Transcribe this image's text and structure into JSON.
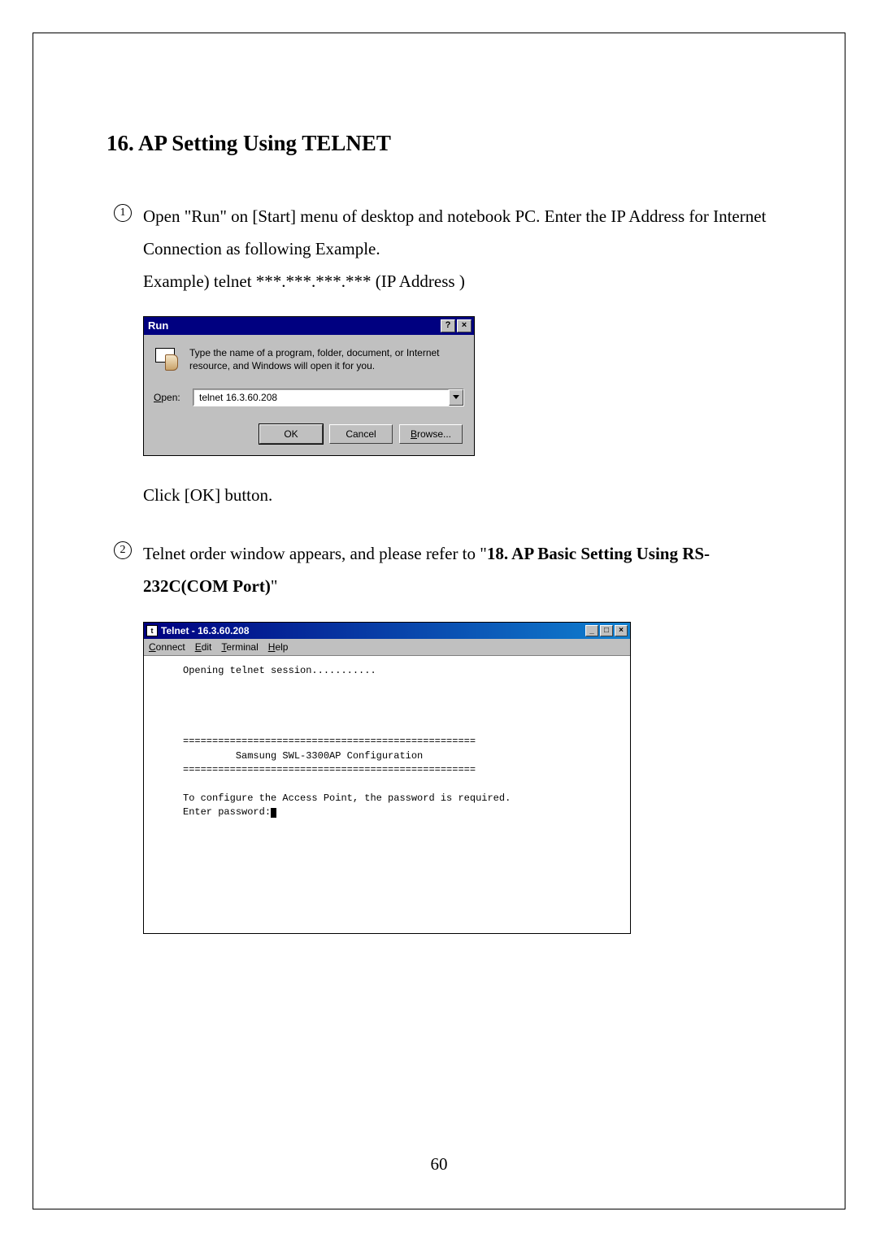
{
  "heading": "16. AP Setting Using TELNET",
  "steps": {
    "item1": {
      "marker": "1",
      "line1": "Open \"Run\" on [Start] menu of desktop and notebook PC. Enter the IP Address for Internet Connection as following Example.",
      "line2": "Example) telnet ***.***.***.*** (IP Address )"
    },
    "click_ok": "Click [OK] button.",
    "item2": {
      "marker": "2",
      "prefix": "Telnet order window appears, and please refer to \"",
      "bold": "18. AP Basic Setting Using RS-232C(COM Port)",
      "suffix": "\""
    }
  },
  "run_dialog": {
    "title": "Run",
    "help_btn": "?",
    "close_btn": "×",
    "description": "Type the name of a program, folder, document, or Internet resource, and Windows will open it for you.",
    "open_label_ul": "O",
    "open_label_rest": "pen:",
    "open_value": "telnet  16.3.60.208",
    "ok": "OK",
    "cancel": "Cancel",
    "browse_ul": "B",
    "browse_rest": "rowse..."
  },
  "telnet": {
    "title": "Telnet - 16.3.60.208",
    "min_btn": "_",
    "max_btn": "□",
    "close_btn": "×",
    "menu": {
      "connect_ul": "C",
      "connect_rest": "onnect",
      "edit_ul": "E",
      "edit_rest": "dit",
      "terminal_ul": "T",
      "terminal_rest": "erminal",
      "help_ul": "H",
      "help_rest": "elp"
    },
    "body_line1": "     Opening telnet session...........",
    "body_sep1": "     ==================================================",
    "body_confg": "              Samsung SWL-3300AP Configuration",
    "body_sep2": "     ==================================================",
    "body_note": "     To configure the Access Point, the password is required.",
    "body_enter": "     Enter password:"
  },
  "page_number": "60"
}
